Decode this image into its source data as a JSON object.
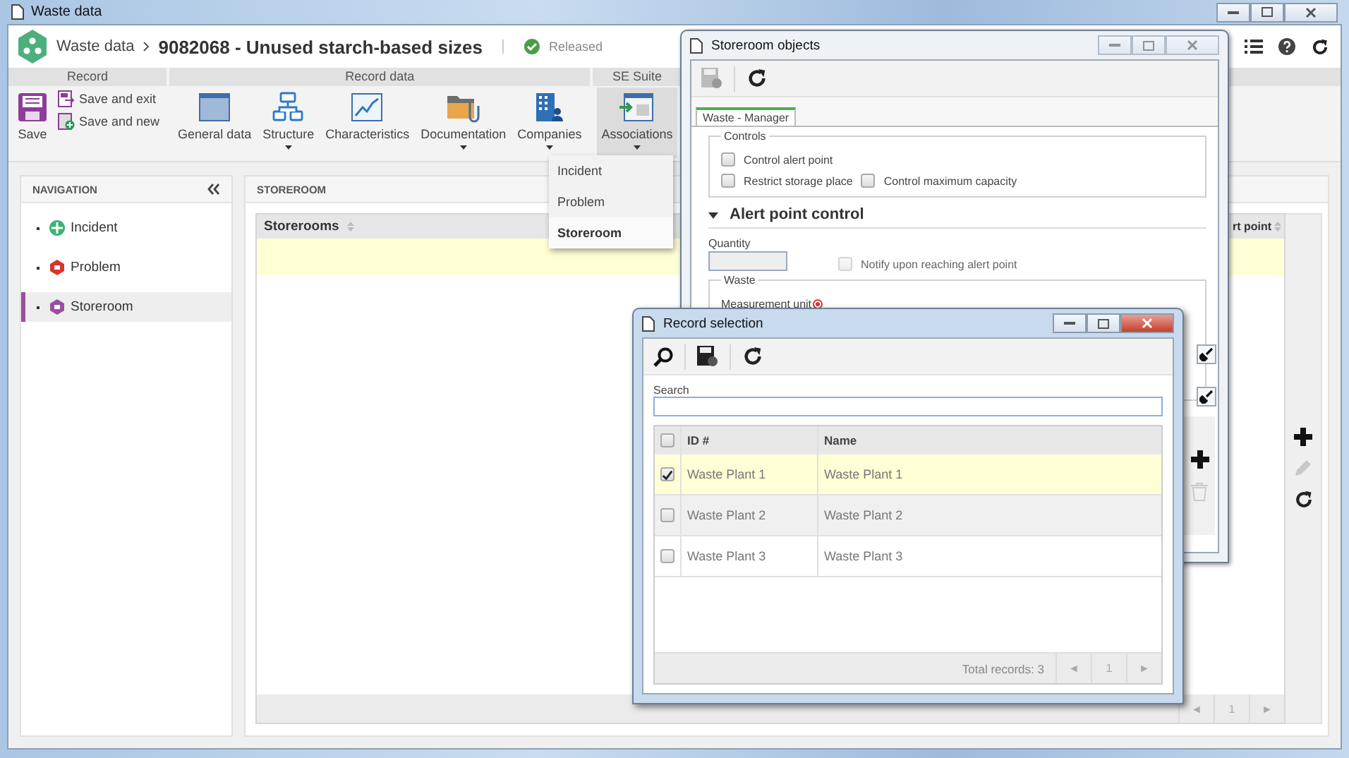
{
  "window": {
    "title": "Waste data"
  },
  "header": {
    "breadcrumb": "Waste data",
    "record_title": "9082068 - Unused starch-based sizes",
    "status": "Released"
  },
  "ribbon": {
    "groups": [
      {
        "title": "Record",
        "buttons": [
          {
            "label": "Save",
            "kind": "large",
            "dropdown": false,
            "pressed": false
          },
          {
            "label": "Save and exit",
            "kind": "small",
            "dropdown": false,
            "pressed": false
          },
          {
            "label": "Save and new",
            "kind": "small",
            "dropdown": false,
            "pressed": false
          }
        ]
      },
      {
        "title": "Record data",
        "buttons": [
          {
            "label": "General data",
            "kind": "large",
            "dropdown": false,
            "pressed": false
          },
          {
            "label": "Structure",
            "kind": "large",
            "dropdown": true,
            "pressed": false
          },
          {
            "label": "Characteristics",
            "kind": "large",
            "dropdown": false,
            "pressed": false
          },
          {
            "label": "Documentation",
            "kind": "large",
            "dropdown": true,
            "pressed": false
          },
          {
            "label": "Companies",
            "kind": "large",
            "dropdown": true,
            "pressed": false
          }
        ]
      },
      {
        "title": "SE Suite",
        "buttons": [
          {
            "label": "Associations",
            "kind": "large",
            "dropdown": true,
            "pressed": true
          }
        ]
      }
    ]
  },
  "associations_menu": {
    "items": [
      {
        "label": "Incident",
        "selected": false
      },
      {
        "label": "Problem",
        "selected": false
      },
      {
        "label": "Storeroom",
        "selected": true
      }
    ]
  },
  "navigation": {
    "title": "NAVIGATION",
    "items": [
      {
        "label": "Incident",
        "selected": false,
        "color": "#3bb273"
      },
      {
        "label": "Problem",
        "selected": false,
        "color": "#d9342b"
      },
      {
        "label": "Storeroom",
        "selected": true,
        "color": "#9b4f9e"
      }
    ]
  },
  "storeroom_panel": {
    "title": "STOREROOM",
    "table": {
      "columns": [
        "Storerooms",
        "rt point"
      ]
    },
    "pager": {
      "previous": "◄",
      "page": "1",
      "next": "►"
    }
  },
  "storeroom_objects_dialog": {
    "title": "Storeroom objects",
    "tabs": [
      {
        "label": "Waste - Manager",
        "selected": true
      }
    ],
    "controls": {
      "title": "Controls",
      "checkboxes": [
        {
          "label": "Control alert point",
          "checked": false
        },
        {
          "label": "Restrict storage place",
          "checked": false
        },
        {
          "label": "Control maximum capacity",
          "checked": false
        }
      ]
    },
    "alert_section": {
      "title": "Alert point control",
      "expanded": true,
      "quantity_label": "Quantity",
      "notify": {
        "label": "Notify upon reaching alert point",
        "checked": false,
        "disabled": true
      }
    },
    "waste": {
      "title": "Waste",
      "measurement_unit_label": "Measurement unit",
      "required": true
    }
  },
  "record_selection_dialog": {
    "title": "Record selection",
    "search_label": "Search",
    "columns": [
      "ID #",
      "Name"
    ],
    "header_checked": false,
    "rows": [
      {
        "id": "Waste Plant 1",
        "name": "Waste Plant 1",
        "checked": true,
        "selected": true
      },
      {
        "id": "Waste Plant 2",
        "name": "Waste Plant 2",
        "checked": false,
        "selected": false
      },
      {
        "id": "Waste Plant 3",
        "name": "Waste Plant 3",
        "checked": false,
        "selected": false
      }
    ],
    "footer": {
      "total": "Total records: 3",
      "previous": "◄",
      "page": "1",
      "next": "►"
    }
  }
}
